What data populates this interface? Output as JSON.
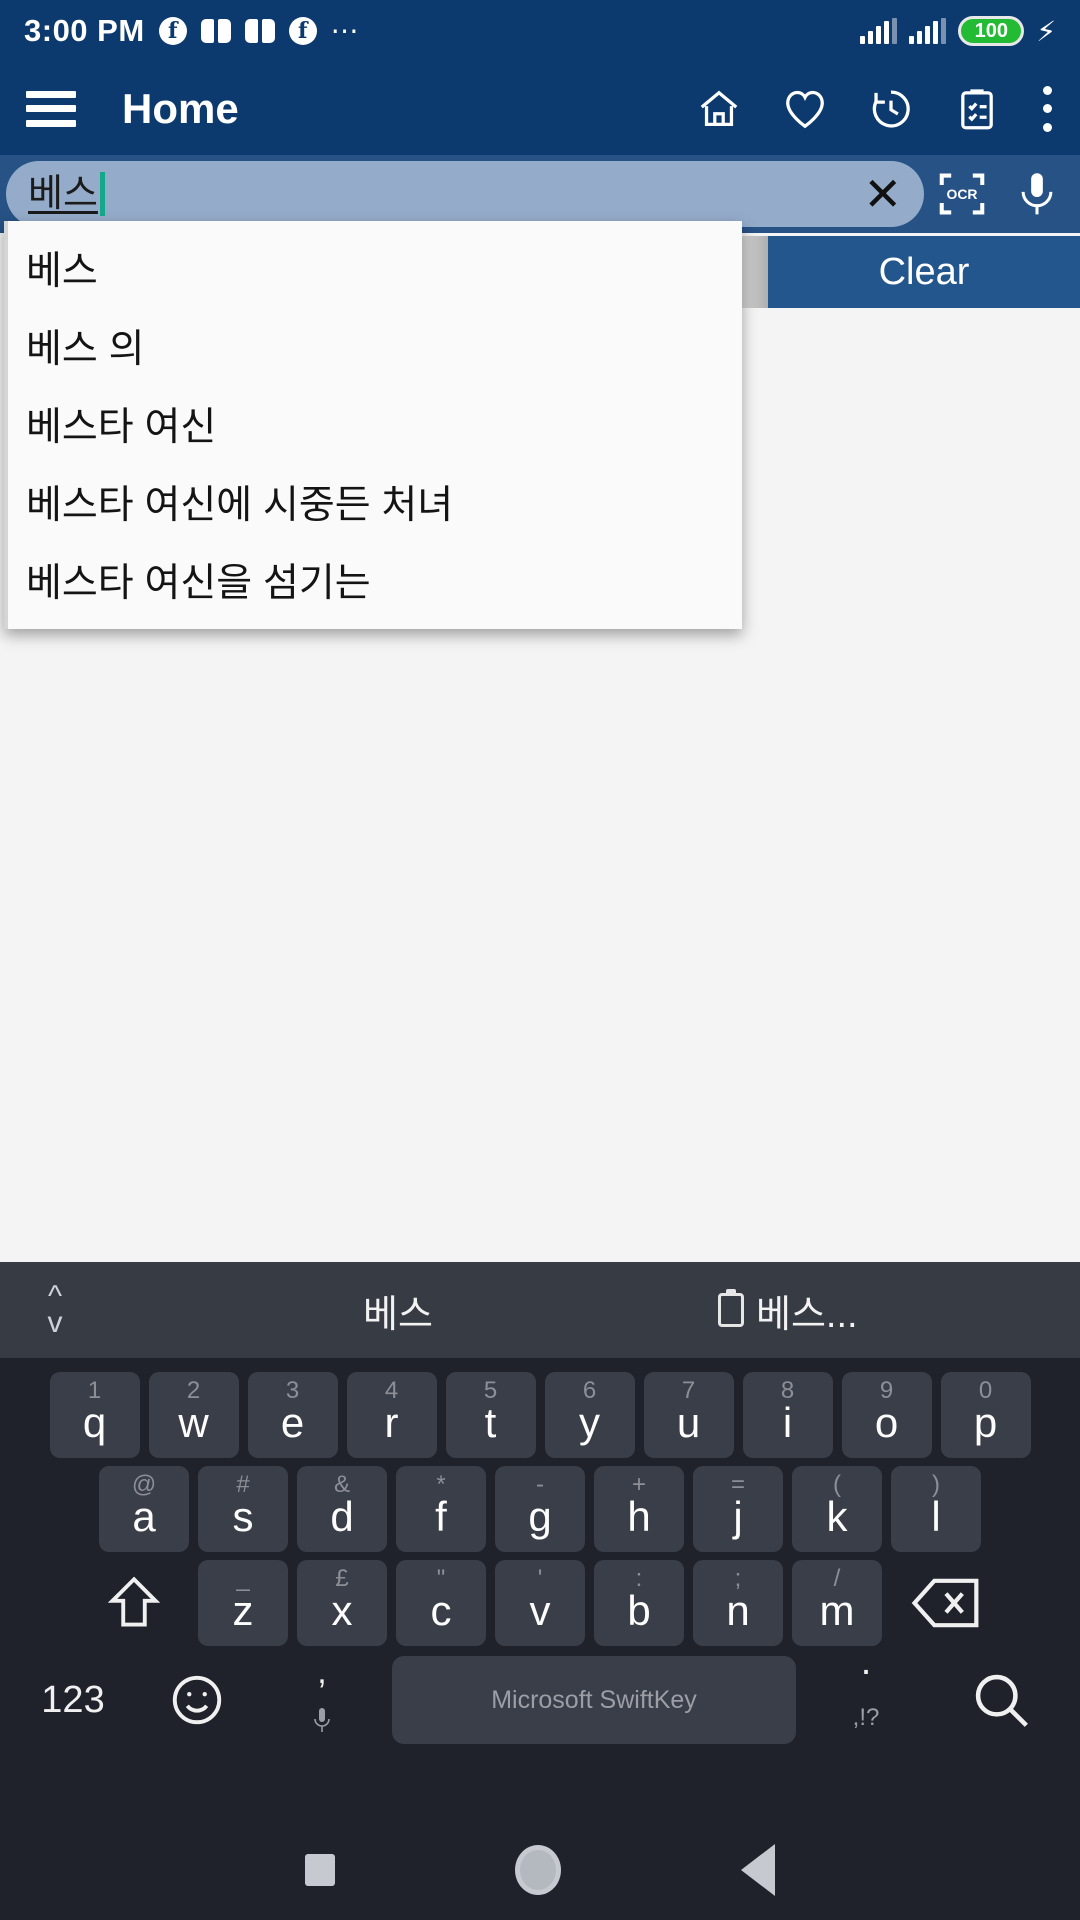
{
  "status_bar": {
    "time": "3:00 PM",
    "icons": [
      "facebook-icon",
      "book-icon",
      "book-icon",
      "facebook-icon",
      "more-notifications-icon"
    ],
    "more_glyph": "⋯",
    "battery_level": "100",
    "charging_glyph": "⚡",
    "signal_bars": 2
  },
  "app_bar": {
    "title": "Home",
    "menu_icon": "hamburger-menu-icon",
    "actions": [
      "home-icon",
      "heart-icon",
      "history-icon",
      "clipboard-checklist-icon",
      "overflow-menu-icon"
    ]
  },
  "search": {
    "query": "베스",
    "clear_glyph": "✕",
    "ocr_label": "OCR",
    "mic_icon": "microphone-icon"
  },
  "clear_button": {
    "label": "Clear"
  },
  "suggestions": [
    {
      "text": "베스"
    },
    {
      "text": "베스 의"
    },
    {
      "text": "베스타 여신"
    },
    {
      "text": "베스타 여신에 시중든 처녀"
    },
    {
      "text": "베스타 여신을 섬기는"
    }
  ],
  "keyboard": {
    "suggestion_bar": {
      "expander_icon": "expand-collapse-icon",
      "center_suggestion": "베스",
      "clipboard_icon": "clipboard-icon",
      "clipboard_suggestion": "베스..."
    },
    "row1": [
      {
        "primary": "q",
        "secondary": "1"
      },
      {
        "primary": "w",
        "secondary": "2"
      },
      {
        "primary": "e",
        "secondary": "3"
      },
      {
        "primary": "r",
        "secondary": "4"
      },
      {
        "primary": "t",
        "secondary": "5"
      },
      {
        "primary": "y",
        "secondary": "6"
      },
      {
        "primary": "u",
        "secondary": "7"
      },
      {
        "primary": "i",
        "secondary": "8"
      },
      {
        "primary": "o",
        "secondary": "9"
      },
      {
        "primary": "p",
        "secondary": "0"
      }
    ],
    "row2": [
      {
        "primary": "a",
        "secondary": "@"
      },
      {
        "primary": "s",
        "secondary": "#"
      },
      {
        "primary": "d",
        "secondary": "&"
      },
      {
        "primary": "f",
        "secondary": "*"
      },
      {
        "primary": "g",
        "secondary": "-"
      },
      {
        "primary": "h",
        "secondary": "+"
      },
      {
        "primary": "j",
        "secondary": "="
      },
      {
        "primary": "k",
        "secondary": "("
      },
      {
        "primary": "l",
        "secondary": ")"
      }
    ],
    "row3": [
      {
        "primary": "z",
        "secondary": "_"
      },
      {
        "primary": "x",
        "secondary": "£"
      },
      {
        "primary": "c",
        "secondary": "\""
      },
      {
        "primary": "v",
        "secondary": "'"
      },
      {
        "primary": "b",
        "secondary": ":"
      },
      {
        "primary": "n",
        "secondary": ";"
      },
      {
        "primary": "m",
        "secondary": "/"
      }
    ],
    "shift_icon": "shift-icon",
    "backspace_icon": "backspace-icon",
    "bottom": {
      "numbers_label": "123",
      "emoji_icon": "emoji-icon",
      "comma_key": ",",
      "comma_mic_icon": "microphone-icon",
      "space_label": "Microsoft SwiftKey",
      "period_secondary": ",!?",
      "period_key": ".",
      "search_icon": "search-icon"
    }
  },
  "nav_bar": {
    "recents_icon": "recents-square-icon",
    "home_icon": "home-circle-icon",
    "back_icon": "back-triangle-icon"
  },
  "colors": {
    "app_bar": "#0d3a6e",
    "search_row": "#265285",
    "search_field": "#94acca",
    "accent_caret": "#14a98a",
    "battery_green": "#22bb33",
    "keyboard_bg": "#1f222a",
    "key_bg": "#3a3e48"
  }
}
